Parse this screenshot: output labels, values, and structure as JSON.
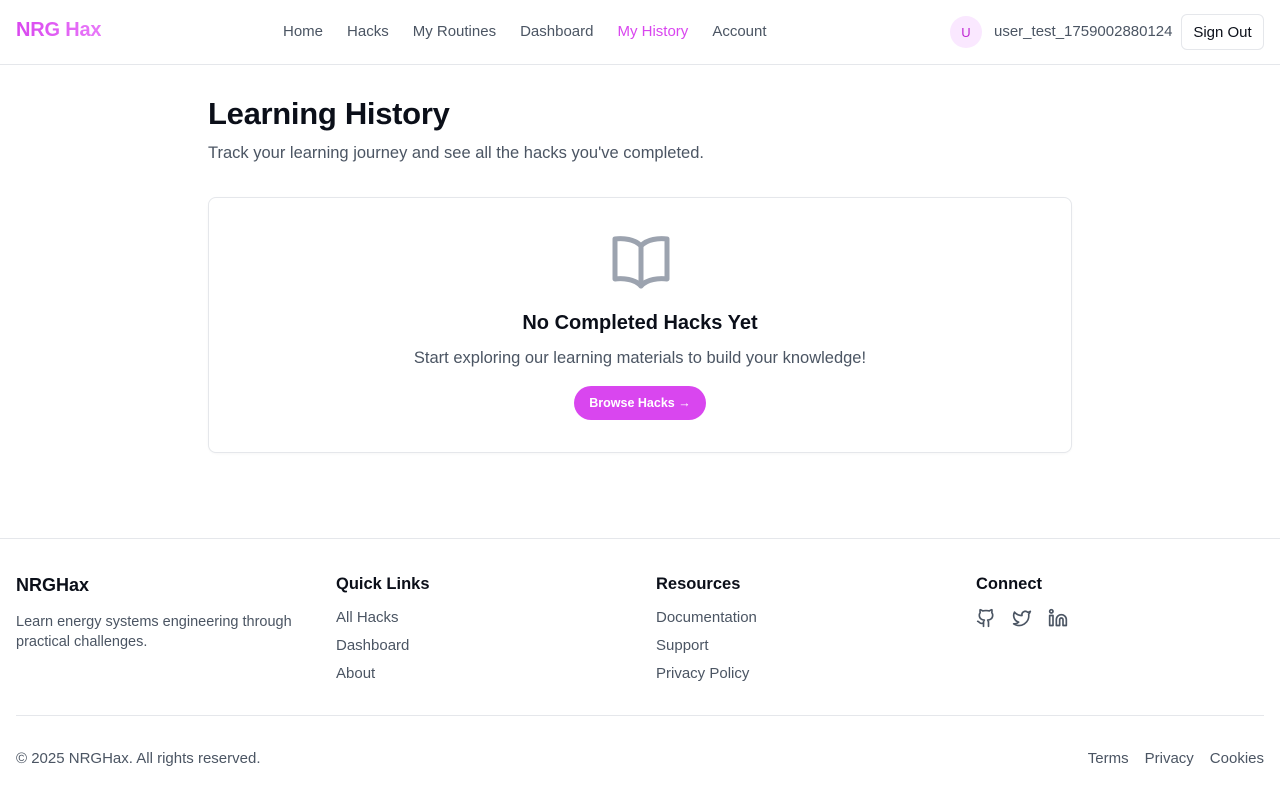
{
  "header": {
    "logo": "NRG Hax",
    "nav": [
      {
        "label": "Home"
      },
      {
        "label": "Hacks"
      },
      {
        "label": "My Routines"
      },
      {
        "label": "Dashboard"
      },
      {
        "label": "My History"
      },
      {
        "label": "Account"
      }
    ],
    "active_nav": "My History",
    "avatar_initial": "U",
    "username": "user_test_1759002880124",
    "sign_out": "Sign Out"
  },
  "main": {
    "title": "Learning History",
    "subtitle": "Track your learning journey and see all the hacks you've completed.",
    "empty_state": {
      "icon": "book-open-icon",
      "title": "No Completed Hacks Yet",
      "text": "Start exploring our learning materials to build your knowledge!",
      "button": "Browse Hacks →"
    }
  },
  "footer": {
    "brand": "NRGHax",
    "description": "Learn energy systems engineering through practical challenges.",
    "quick_links": {
      "heading": "Quick Links",
      "links": [
        "All Hacks",
        "Dashboard",
        "About"
      ]
    },
    "resources": {
      "heading": "Resources",
      "links": [
        "Documentation",
        "Support",
        "Privacy Policy"
      ]
    },
    "connect": {
      "heading": "Connect",
      "icons": [
        "github-icon",
        "twitter-icon",
        "linkedin-icon"
      ]
    },
    "copyright": "© 2025 NRGHax. All rights reserved.",
    "legal": [
      "Terms",
      "Privacy",
      "Cookies"
    ]
  },
  "colors": {
    "accent": "#d946ef",
    "text_muted": "#4b5563",
    "border": "#e5e7eb"
  }
}
